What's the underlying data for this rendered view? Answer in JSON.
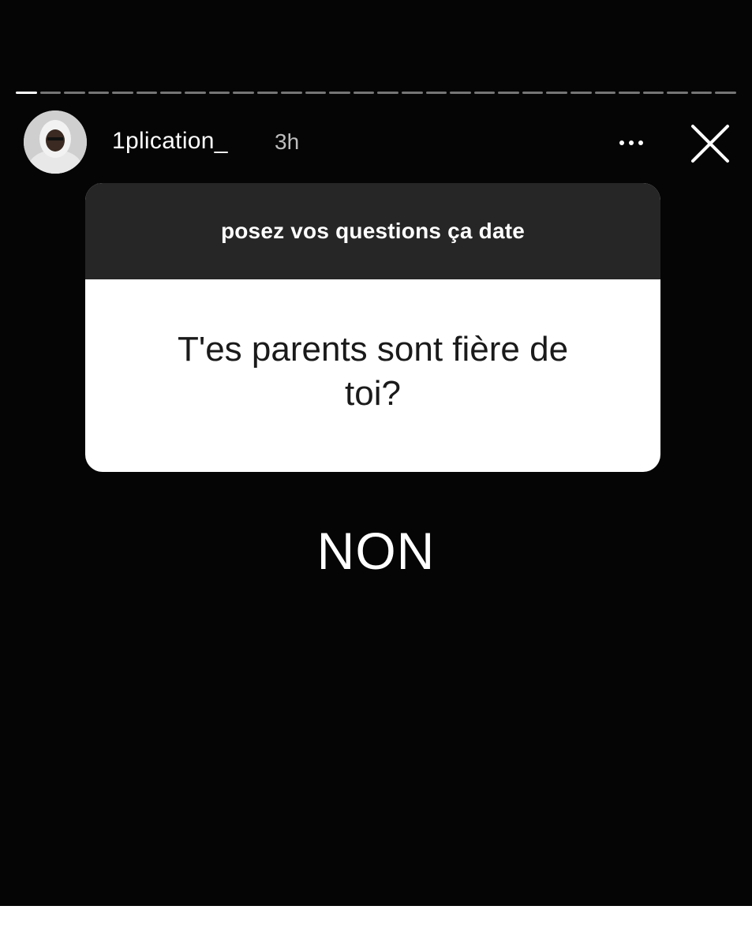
{
  "story": {
    "progress_total": 30,
    "progress_done": 1,
    "user": {
      "username": "1plication_",
      "time": "3h"
    },
    "question_box": {
      "prompt": "posez vos questions ça date",
      "question": "T'es parents sont fière de toi?"
    },
    "answer": "NON",
    "icons": {
      "more": "more-options-icon",
      "close": "close-icon",
      "avatar": "profile-avatar"
    },
    "colors": {
      "background": "#050505",
      "box_header": "#262626",
      "box_body": "#ffffff",
      "text_light": "#ffffff"
    }
  }
}
